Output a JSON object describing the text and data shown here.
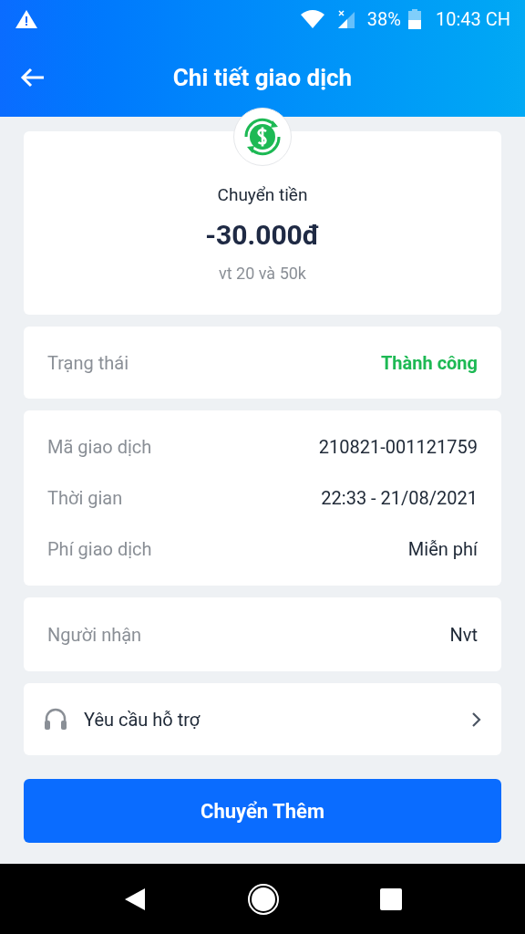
{
  "status_bar": {
    "battery": "38%",
    "time": "10:43 CH"
  },
  "header": {
    "title": "Chi tiết giao dịch"
  },
  "summary": {
    "type": "Chuyển tiền",
    "amount": "-30.000đ",
    "note": "vt 20 và 50k"
  },
  "status": {
    "label": "Trạng thái",
    "value": "Thành công"
  },
  "details": [
    {
      "label": "Mã giao dịch",
      "value": "210821-001121759"
    },
    {
      "label": "Thời gian",
      "value": "22:33 - 21/08/2021"
    },
    {
      "label": "Phí giao dịch",
      "value": "Miễn phí"
    }
  ],
  "recipient": {
    "label": "Người nhận",
    "value": "Nvt"
  },
  "support": {
    "label": "Yêu cầu hỗ trợ"
  },
  "primary_button": {
    "label": "Chuyển Thêm"
  }
}
